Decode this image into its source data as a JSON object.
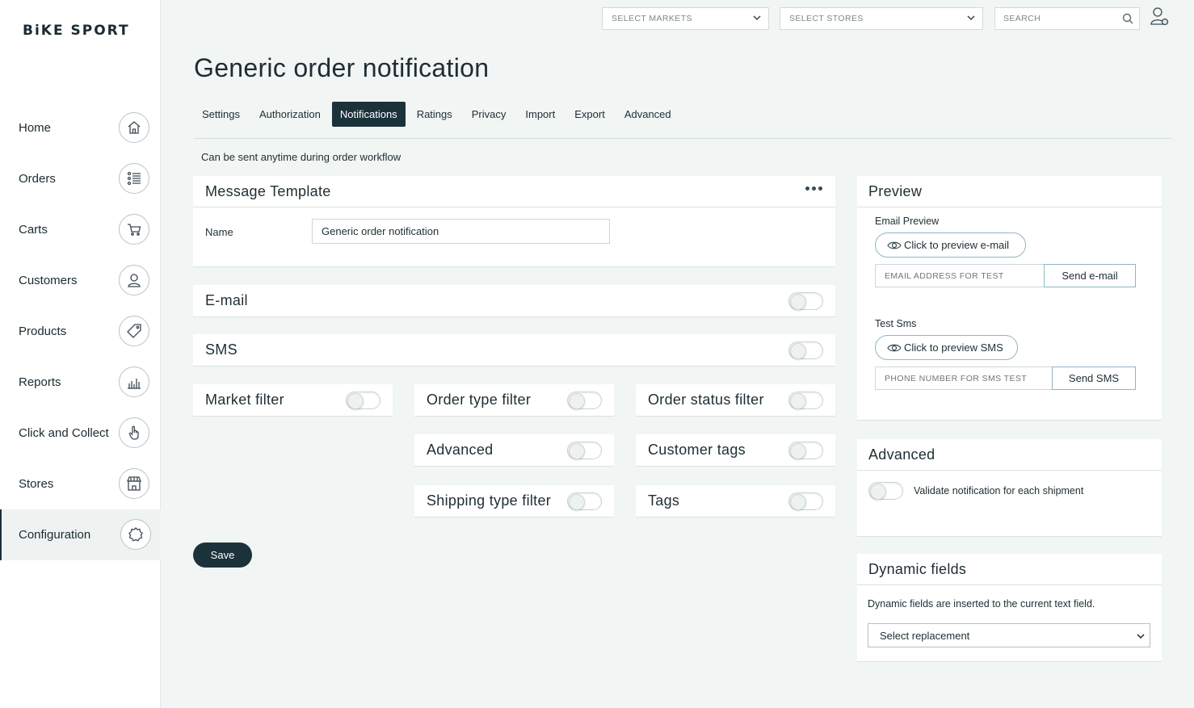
{
  "brand": {
    "logo_text": "BiKE SPORT"
  },
  "sidebar": {
    "items": [
      {
        "label": "Home",
        "icon": "home-icon"
      },
      {
        "label": "Orders",
        "icon": "list-icon"
      },
      {
        "label": "Carts",
        "icon": "cart-icon"
      },
      {
        "label": "Customers",
        "icon": "customer-icon"
      },
      {
        "label": "Products",
        "icon": "tag-icon"
      },
      {
        "label": "Reports",
        "icon": "bar-chart-icon"
      },
      {
        "label": "Click and Collect",
        "icon": "hand-pointer-icon"
      },
      {
        "label": "Stores",
        "icon": "store-icon"
      },
      {
        "label": "Configuration",
        "icon": "gear-icon",
        "active": true
      }
    ]
  },
  "topbar": {
    "markets_placeholder": "SELECT MARKETS",
    "stores_placeholder": "SELECT STORES",
    "search_placeholder": "SEARCH"
  },
  "page": {
    "title": "Generic order notification",
    "subtitle": "Can be sent anytime during order workflow"
  },
  "tabs": [
    {
      "label": "Settings"
    },
    {
      "label": "Authorization"
    },
    {
      "label": "Notifications",
      "active": true
    },
    {
      "label": "Ratings"
    },
    {
      "label": "Privacy"
    },
    {
      "label": "Import"
    },
    {
      "label": "Export"
    },
    {
      "label": "Advanced"
    }
  ],
  "message_template": {
    "title": "Message Template",
    "name_label": "Name",
    "name_value": "Generic order notification"
  },
  "channels": {
    "email": {
      "label": "E-mail",
      "enabled": false
    },
    "sms": {
      "label": "SMS",
      "enabled": false
    }
  },
  "filters": {
    "market": {
      "label": "Market filter",
      "enabled": false
    },
    "order_type": {
      "label": "Order type filter",
      "enabled": false
    },
    "order_status": {
      "label": "Order status filter",
      "enabled": false
    },
    "advanced": {
      "label": "Advanced",
      "enabled": false
    },
    "customer_tags": {
      "label": "Customer tags",
      "enabled": false
    },
    "shipping_type": {
      "label": "Shipping type filter",
      "enabled": false
    },
    "tags": {
      "label": "Tags",
      "enabled": false
    }
  },
  "actions": {
    "save_label": "Save"
  },
  "preview": {
    "title": "Preview",
    "email_label": "Email Preview",
    "email_preview_button": "Click to preview e-mail",
    "email_input_placeholder": "EMAIL ADDRESS FOR TEST",
    "send_email_button": "Send e-mail",
    "sms_label": "Test Sms",
    "sms_preview_button": "Click to preview SMS",
    "sms_input_placeholder": "PHONE NUMBER FOR SMS TEST",
    "send_sms_button": "Send SMS"
  },
  "advanced": {
    "title": "Advanced",
    "validate_label": "Validate notification for each shipment",
    "validate_enabled": false
  },
  "dynamic_fields": {
    "title": "Dynamic fields",
    "description": "Dynamic fields are inserted to the current text field.",
    "select_value": "Select replacement"
  },
  "colors": {
    "accent_dark": "#1c323b",
    "background": "#f1f5f4",
    "pill_border": "#8fb7c2"
  }
}
